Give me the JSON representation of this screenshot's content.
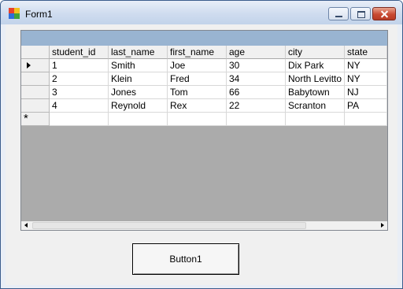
{
  "window": {
    "title": "Form1",
    "icon": "app-icon",
    "icon_colors": [
      "#e8412c",
      "#f3c01c",
      "#2f6ed9",
      "#42a33a"
    ]
  },
  "grid": {
    "columns": [
      "student_id",
      "last_name",
      "first_name",
      "age",
      "city",
      "state"
    ],
    "rows": [
      [
        "1",
        "Smith",
        "Joe",
        "30",
        "Dix Park",
        "NY"
      ],
      [
        "2",
        "Klein",
        "Fred",
        "34",
        "North Levitto",
        "NY"
      ],
      [
        "3",
        "Jones",
        "Tom",
        "66",
        "Babytown",
        "NJ"
      ],
      [
        "4",
        "Reynold",
        "Rex",
        "22",
        "Scranton",
        "PA"
      ]
    ],
    "current_row_marker": "▶",
    "new_row_marker": "*"
  },
  "button1": {
    "label": "Button1"
  },
  "colors": {
    "grid_caption": "#99b4d1",
    "grid_background": "#ababab"
  }
}
